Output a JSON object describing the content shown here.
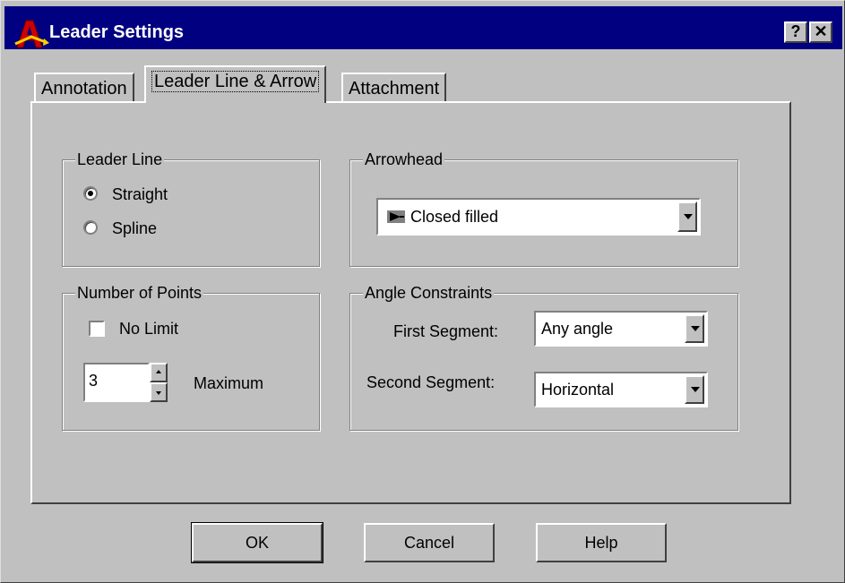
{
  "window": {
    "title": "Leader Settings",
    "help_button": "?",
    "close_button": "✕"
  },
  "tabs": [
    {
      "label": "Annotation",
      "active": false
    },
    {
      "label": "Leader Line & Arrow",
      "active": true
    },
    {
      "label": "Attachment",
      "active": false
    }
  ],
  "leader_line": {
    "title": "Leader Line",
    "options": [
      {
        "label": "Straight",
        "selected": true
      },
      {
        "label": "Spline",
        "selected": false
      }
    ]
  },
  "arrowhead": {
    "title": "Arrowhead",
    "value": "Closed filled"
  },
  "number_of_points": {
    "title": "Number of Points",
    "no_limit_label": "No Limit",
    "no_limit_checked": false,
    "value": "3",
    "maximum_label": "Maximum"
  },
  "angle_constraints": {
    "title": "Angle Constraints",
    "first_segment_label": "First Segment:",
    "first_segment_value": "Any angle",
    "second_segment_label": "Second Segment:",
    "second_segment_value": "Horizontal"
  },
  "buttons": {
    "ok": "OK",
    "cancel": "Cancel",
    "help": "Help"
  },
  "colors": {
    "title_bar": "#000080",
    "face": "#c0c0c0"
  }
}
